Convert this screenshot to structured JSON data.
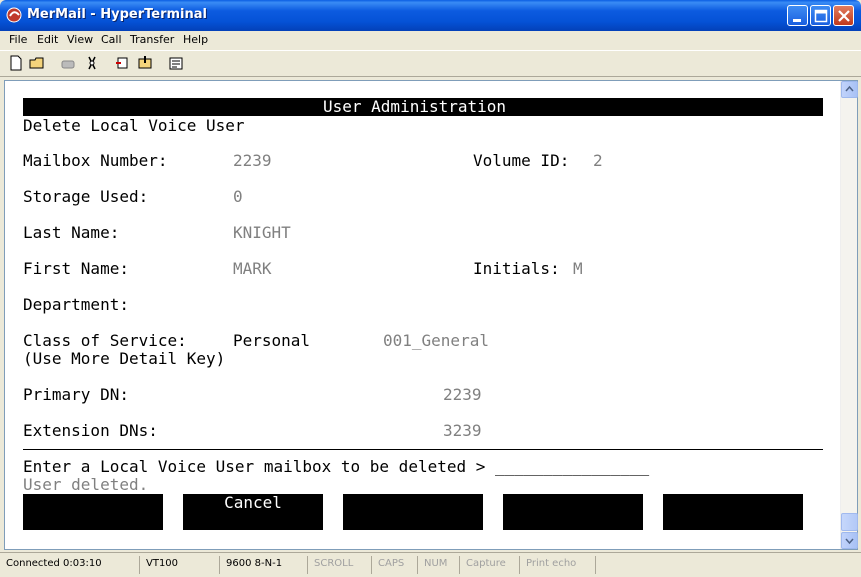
{
  "window": {
    "title": "MerMail - HyperTerminal"
  },
  "menu": [
    "File",
    "Edit",
    "View",
    "Call",
    "Transfer",
    "Help"
  ],
  "terminal": {
    "header": "User Administration",
    "screen_title": "Delete Local Voice User",
    "fields": {
      "mailbox_label": "Mailbox Number:",
      "mailbox_value": "2239",
      "volume_label": "Volume ID:",
      "volume_value": "2",
      "storage_label": "Storage Used:",
      "storage_value": "0",
      "last_name_label": "Last Name:",
      "last_name_value": "KNIGHT",
      "first_name_label": "First Name:",
      "first_name_value": "MARK",
      "initials_label": "Initials:",
      "initials_value": "M",
      "department_label": "Department:",
      "cos_label": "Class of Service:",
      "cos_type": "Personal",
      "cos_value": "001_General",
      "cos_hint": "(Use More Detail Key)",
      "primary_dn_label": "Primary DN:",
      "primary_dn_value": "2239",
      "extension_dns_label": "Extension DNs:",
      "extension_dns_value": "3239"
    },
    "prompt": "Enter a Local Voice User mailbox to be deleted > ________________",
    "status_message": "User deleted.",
    "softkeys": [
      "",
      "Cancel",
      "",
      "",
      ""
    ]
  },
  "statusbar": {
    "connected": "Connected 0:03:10",
    "emulation": "VT100",
    "settings": "9600 8-N-1",
    "scroll": "SCROLL",
    "caps": "CAPS",
    "num": "NUM",
    "capture": "Capture",
    "print_echo": "Print echo"
  }
}
